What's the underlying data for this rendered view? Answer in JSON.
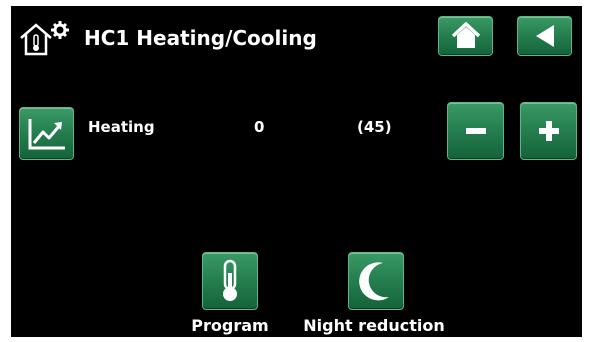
{
  "header": {
    "title": "HC1 Heating/Cooling",
    "icon": "house-thermometer-gear-icon",
    "home_icon": "home-icon",
    "back_icon": "back-arrow-icon"
  },
  "heating_row": {
    "chart_icon": "trend-chart-icon",
    "label": "Heating",
    "value": "0",
    "setpoint": "(45)",
    "minus_icon": "minus-icon",
    "plus_icon": "plus-icon"
  },
  "bottom": {
    "program": {
      "label": "Program",
      "icon": "thermometer-icon"
    },
    "night": {
      "label": "Night reduction",
      "icon": "moon-icon"
    }
  },
  "colors": {
    "background": "#000000",
    "button_green": "#268050",
    "text": "#ffffff"
  }
}
